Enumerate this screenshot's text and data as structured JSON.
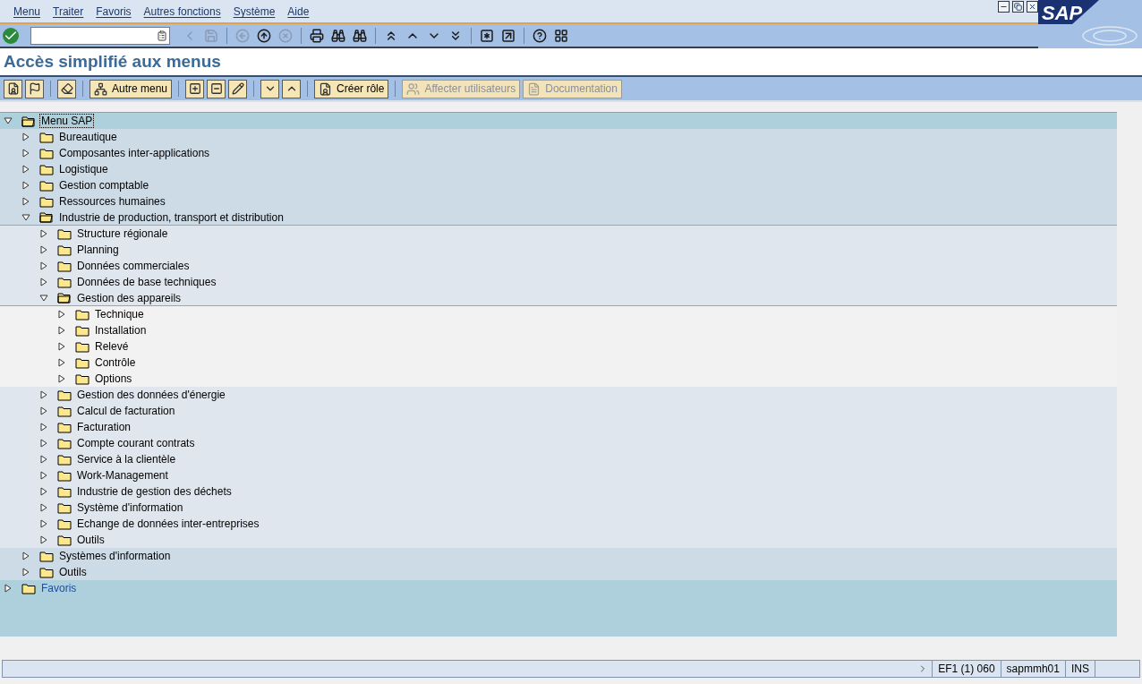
{
  "menu_bar": [
    "Menu",
    "Traiter",
    "Favoris",
    "Autres fonctions",
    "Système",
    "Aide"
  ],
  "title": "Accès simplifié aux menus",
  "logo": "SAP",
  "app_toolbar": [
    {
      "kind": "icon",
      "disabled": false
    },
    {
      "kind": "icon",
      "disabled": false
    },
    {
      "kind": "sep"
    },
    {
      "kind": "icon",
      "disabled": false
    },
    {
      "kind": "sep"
    },
    {
      "kind": "text",
      "label": "Autre menu",
      "disabled": false
    },
    {
      "kind": "sep"
    },
    {
      "kind": "icon",
      "disabled": false
    },
    {
      "kind": "icon",
      "disabled": false
    },
    {
      "kind": "icon",
      "disabled": false
    },
    {
      "kind": "sep"
    },
    {
      "kind": "icon",
      "disabled": false
    },
    {
      "kind": "icon",
      "disabled": false
    },
    {
      "kind": "sep"
    },
    {
      "kind": "text",
      "label": "Créer rôle",
      "disabled": false
    },
    {
      "kind": "sep"
    },
    {
      "kind": "text",
      "label": "Affecter utilisateurs",
      "disabled": true
    },
    {
      "kind": "text",
      "label": "Documentation",
      "disabled": true
    }
  ],
  "tree": [
    {
      "label": "Menu SAP",
      "expanded": true,
      "selected": true,
      "children": [
        {
          "label": "Bureautique",
          "expanded": false,
          "selected": false
        },
        {
          "label": "Composantes inter-applications",
          "expanded": false,
          "selected": false
        },
        {
          "label": "Logistique",
          "expanded": false,
          "selected": false
        },
        {
          "label": "Gestion comptable",
          "expanded": false,
          "selected": false
        },
        {
          "label": "Ressources humaines",
          "expanded": false,
          "selected": false
        },
        {
          "label": "Industrie de production, transport et distribution",
          "expanded": true,
          "selected": false,
          "children": [
            {
              "label": "Structure régionale",
              "expanded": false,
              "selected": false
            },
            {
              "label": "Planning",
              "expanded": false,
              "selected": false
            },
            {
              "label": "Données commerciales",
              "expanded": false,
              "selected": false
            },
            {
              "label": "Données de base techniques",
              "expanded": false,
              "selected": false
            },
            {
              "label": "Gestion des appareils",
              "expanded": true,
              "selected": false,
              "children": [
                {
                  "label": "Technique",
                  "expanded": false,
                  "selected": false
                },
                {
                  "label": "Installation",
                  "expanded": false,
                  "selected": false
                },
                {
                  "label": "Relevé",
                  "expanded": false,
                  "selected": false
                },
                {
                  "label": "Contrôle",
                  "expanded": false,
                  "selected": false
                },
                {
                  "label": "Options",
                  "expanded": false,
                  "selected": false
                }
              ]
            },
            {
              "label": "Gestion des données d'énergie",
              "expanded": false,
              "selected": false
            },
            {
              "label": "Calcul de facturation",
              "expanded": false,
              "selected": false
            },
            {
              "label": "Facturation",
              "expanded": false,
              "selected": false
            },
            {
              "label": "Compte courant contrats",
              "expanded": false,
              "selected": false
            },
            {
              "label": "Service à la clientèle",
              "expanded": false,
              "selected": false
            },
            {
              "label": "Work-Management",
              "expanded": false,
              "selected": false
            },
            {
              "label": "Industrie de gestion des déchets",
              "expanded": false,
              "selected": false
            },
            {
              "label": "Système d'information",
              "expanded": false,
              "selected": false
            },
            {
              "label": "Echange de données inter-entreprises",
              "expanded": false,
              "selected": false
            },
            {
              "label": "Outils",
              "expanded": false,
              "selected": false
            }
          ]
        },
        {
          "label": "Systèmes d'information",
          "expanded": false,
          "selected": false
        },
        {
          "label": "Outils",
          "expanded": false,
          "selected": false
        }
      ]
    },
    {
      "label": "Favoris",
      "expanded": false,
      "selected": false
    }
  ],
  "status_bar": [
    "EF1 (1) 060",
    "sapmmh01",
    "INS"
  ]
}
